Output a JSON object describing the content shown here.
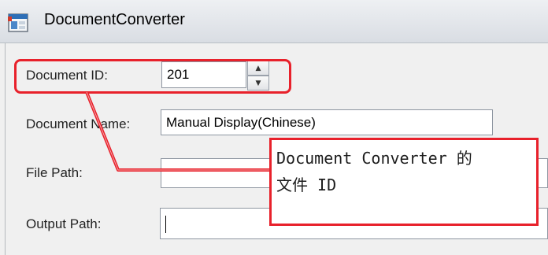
{
  "window": {
    "title": "DocumentConverter",
    "icon": "app-window-icon"
  },
  "form": {
    "document_id": {
      "label": "Document ID:",
      "value": "201"
    },
    "document_name": {
      "label": "Document Name:",
      "value": "Manual Display(Chinese)"
    },
    "file_path": {
      "label": "File Path:",
      "value": ""
    },
    "output_path": {
      "label": "Output Path:",
      "value": ""
    }
  },
  "annotation": {
    "line1": "Document Converter 的",
    "line2": "文件 ID",
    "color": "#e8212b"
  }
}
